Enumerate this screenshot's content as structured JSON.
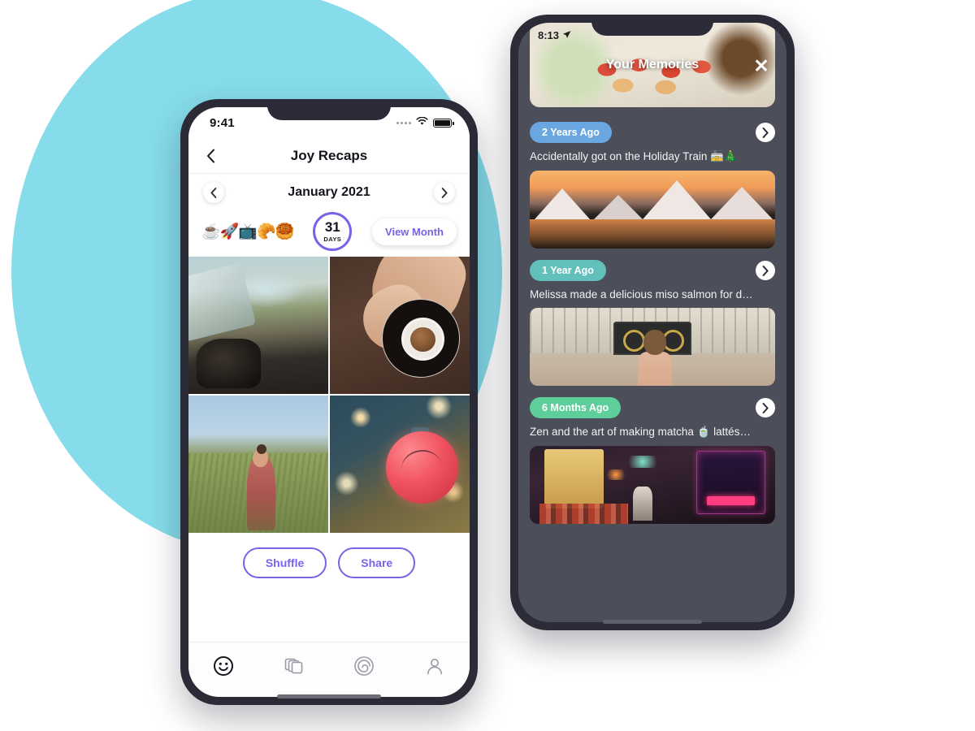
{
  "theme": {
    "background_circle_color": "#86dcea",
    "accent_purple": "#7b61e8",
    "phone_body_dark": "#2b2b38",
    "right_screen_bg": "#4c4f5a"
  },
  "left_phone": {
    "status_bar": {
      "time": "9:41",
      "wifi_icon": "wifi-icon",
      "battery_icon": "battery-icon",
      "signal_icon": "signal-dots-icon"
    },
    "nav": {
      "back_icon": "chevron-left-icon",
      "title": "Joy Recaps"
    },
    "month_selector": {
      "prev_icon": "chevron-left-icon",
      "label": "January 2021",
      "next_icon": "chevron-right-icon"
    },
    "summary": {
      "emojis": "☕🚀📺🥐🥮",
      "days_count": "31",
      "days_caption": "DAYS",
      "days_ring_color": "#7b61e8",
      "view_month_label": "View Month"
    },
    "photos": [
      {
        "name": "photo-car-drive",
        "alt": "Hands on a steering wheel driving through countryside"
      },
      {
        "name": "photo-coffee-cup",
        "alt": "Hand reaching for an espresso cup on a saucer"
      },
      {
        "name": "photo-woman-field",
        "alt": "Woman standing in a tall green field"
      },
      {
        "name": "photo-christmas-ornament",
        "alt": "Red christmas bauble on a lit tree"
      }
    ],
    "actions": {
      "shuffle_label": "Shuffle",
      "share_label": "Share"
    },
    "tabbar": [
      {
        "name": "tab-feed",
        "icon": "smiley-face-icon",
        "active": true
      },
      {
        "name": "tab-collections",
        "icon": "stacked-cards-icon",
        "active": false
      },
      {
        "name": "tab-recaps",
        "icon": "spiral-icon",
        "active": false
      },
      {
        "name": "tab-profile",
        "icon": "person-icon",
        "active": false
      }
    ]
  },
  "right_phone": {
    "status_bar": {
      "time": "8:13",
      "location_icon": "location-arrow-icon"
    },
    "hero": {
      "title": "Your Memories",
      "close_icon": "close-x-icon",
      "alt": "Plate of tomato bruschetta appetizers"
    },
    "memories": [
      {
        "age_label": "2 Years Ago",
        "age_color": "#6aa6e0",
        "caption": "Accidentally got on the Holiday Train 🚋🎄",
        "chevron_icon": "chevron-right-icon",
        "photo_name": "photo-mountains-sunset",
        "photo_alt": "Snow capped mountains reflected in a lake at sunset"
      },
      {
        "age_label": "1 Year Ago",
        "age_color": "#62c0bb",
        "caption": "Melissa made a delicious miso salmon for d…",
        "chevron_icon": "chevron-right-icon",
        "photo_name": "photo-palace-gates",
        "photo_alt": "Woman facing ornate palace gates"
      },
      {
        "age_label": "6 Months Ago",
        "age_color": "#5ecf9a",
        "caption": "Zen and the art of making matcha 🍵 lattés…",
        "chevron_icon": "chevron-right-icon",
        "photo_name": "photo-tokyo-alley",
        "photo_alt": "Neon lit Tokyo alley with 酒場 RIBERY sign"
      }
    ]
  }
}
